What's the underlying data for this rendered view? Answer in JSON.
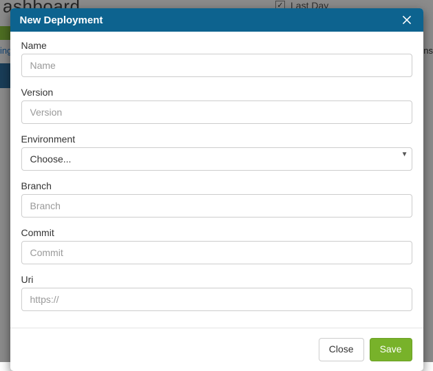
{
  "bg": {
    "title_fragment": "ashboard",
    "checkbox_label": "Last Day",
    "link_fragment": "ing",
    "right_fragment": "ns"
  },
  "modal": {
    "title": "New Deployment",
    "fields": {
      "name": {
        "label": "Name",
        "placeholder": "Name",
        "value": ""
      },
      "version": {
        "label": "Version",
        "placeholder": "Version",
        "value": ""
      },
      "environment": {
        "label": "Environment",
        "selected": "Choose..."
      },
      "branch": {
        "label": "Branch",
        "placeholder": "Branch",
        "value": ""
      },
      "commit": {
        "label": "Commit",
        "placeholder": "Commit",
        "value": ""
      },
      "uri": {
        "label": "Uri",
        "placeholder": "https://",
        "value": ""
      }
    },
    "buttons": {
      "close": "Close",
      "save": "Save"
    }
  }
}
